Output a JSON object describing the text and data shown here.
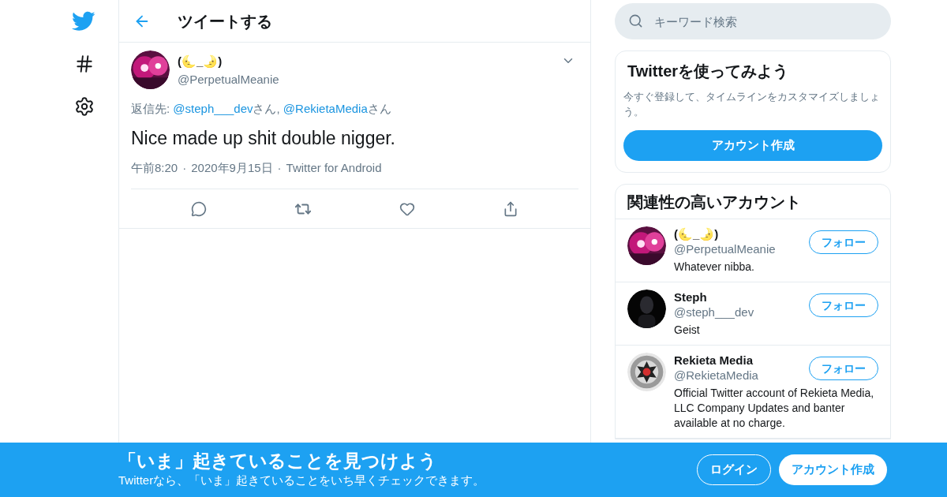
{
  "header": {
    "title": "ツイートする"
  },
  "tweet": {
    "name": "(🌜_🌛)",
    "handle": "@PerpetualMeanie",
    "reply_prefix": "返信先: ",
    "reply_to": [
      {
        "handle": "@steph___dev",
        "suffix": "さん, "
      },
      {
        "handle": "@RekietaMedia",
        "suffix": "さん"
      }
    ],
    "text": "Nice made up shit double nigger.",
    "meta": [
      "午前8:20",
      "2020年9月15日",
      "Twitter for Android"
    ],
    "separator": "·"
  },
  "search": {
    "placeholder": "キーワード検索"
  },
  "signup_card": {
    "title": "Twitterを使ってみよう",
    "text": "今すぐ登録して、タイムラインをカスタマイズしましょう。",
    "button": "アカウント作成"
  },
  "related": {
    "title": "関連性の高いアカウント",
    "accounts": [
      {
        "name": "(🌜_🌛)",
        "handle": "@PerpetualMeanie",
        "bio": "Whatever nibba.",
        "button": "フォロー"
      },
      {
        "name": "Steph",
        "handle": "@steph___dev",
        "bio": "Geist",
        "button": "フォロー"
      },
      {
        "name": "Rekieta Media",
        "handle": "@RekietaMedia",
        "bio": "Official Twitter account of Rekieta Media, LLC Company Updates and banter available at no charge.",
        "button": "フォロー"
      }
    ]
  },
  "banner": {
    "title": "「いま」起きていることを見つけよう",
    "text": "Twitterなら、「いま」起きていることをいち早くチェックできます。",
    "login": "ログイン",
    "signup": "アカウント作成"
  }
}
